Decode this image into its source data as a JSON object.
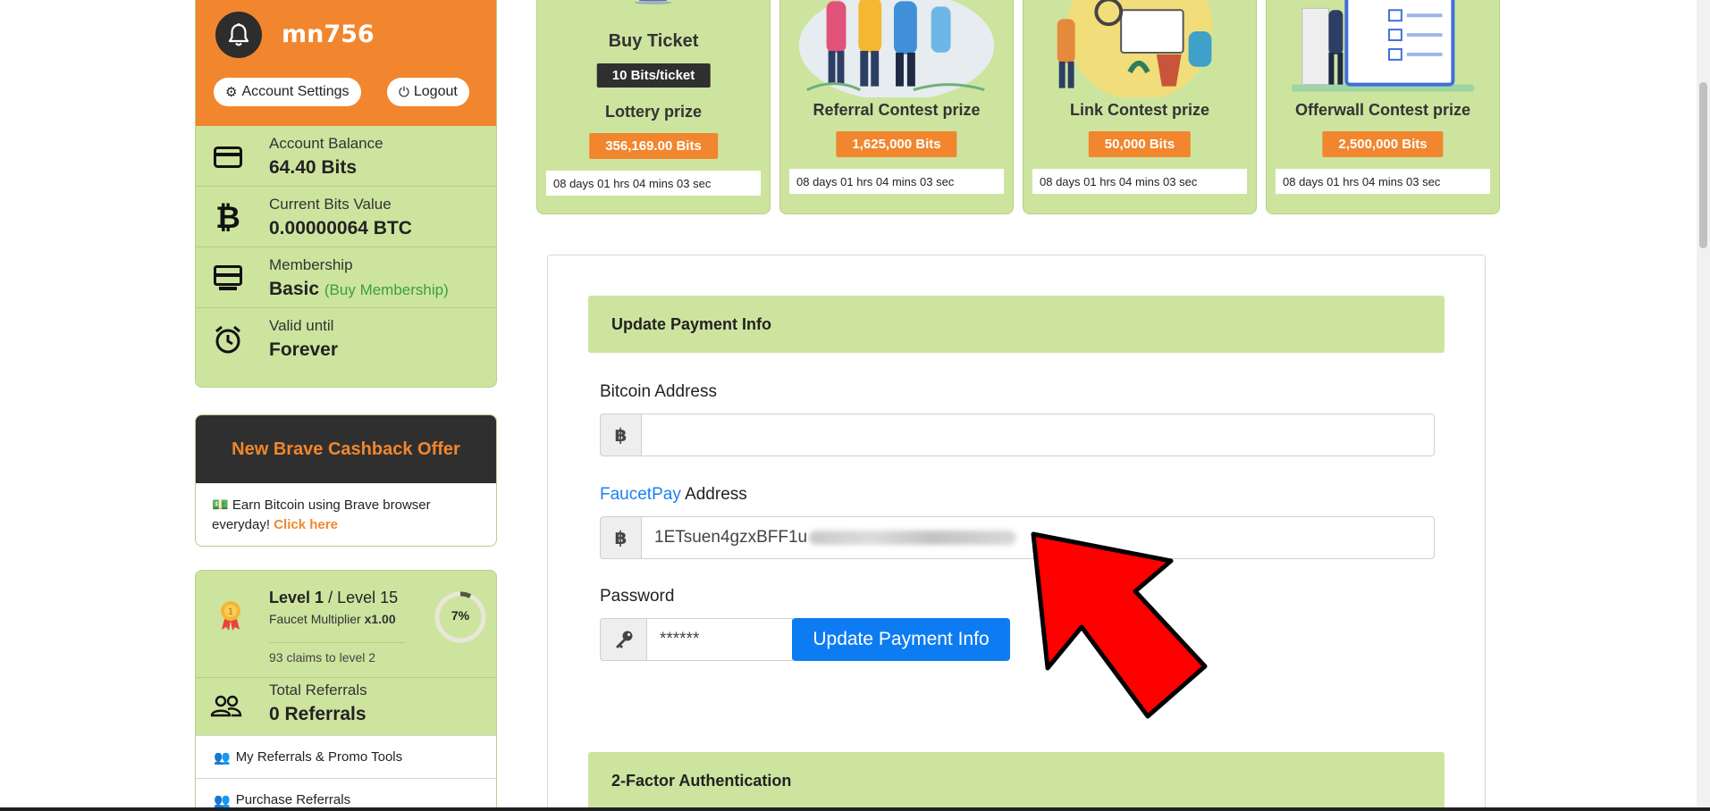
{
  "user": {
    "username": "mn756",
    "account_settings_label": "Account Settings",
    "logout_label": "Logout"
  },
  "stats": {
    "balance_label": "Account Balance",
    "balance_value": "64.40 Bits",
    "bits_value_label": "Current Bits Value",
    "bits_value": "0.00000064 BTC",
    "membership_label": "Membership",
    "membership_value": "Basic",
    "buy_membership": "(Buy Membership)",
    "valid_label": "Valid until",
    "valid_value": "Forever"
  },
  "brave": {
    "title": "New Brave Cashback Offer",
    "text": "Earn Bitcoin using Brave browser everyday!",
    "link": "Click here"
  },
  "level": {
    "current": "Level 1",
    "max": "/ Level 15",
    "multiplier_label": "Faucet Multiplier",
    "multiplier_value": "x1.00",
    "claims": "93 claims to level 2",
    "progress_text": "7%",
    "progress": 0.07
  },
  "referrals": {
    "label": "Total Referrals",
    "value": "0 Referrals",
    "promo_link": "My Referrals & Promo Tools",
    "purchase_link": "Purchase Referrals"
  },
  "contests": {
    "lottery": {
      "title": "Buy Ticket",
      "price": "10 Bits/ticket",
      "prize_label": "Lottery prize",
      "prize": "356,169.00 Bits",
      "timer": "08 days 01 hrs 04 mins 03 sec"
    },
    "referral": {
      "title": "Referral Contest prize",
      "prize": "1,625,000 Bits",
      "timer": "08 days 01 hrs 04 mins 03 sec"
    },
    "link": {
      "title": "Link Contest prize",
      "prize": "50,000 Bits",
      "timer": "08 days 01 hrs 04 mins 03 sec"
    },
    "offerwall": {
      "title": "Offerwall Contest prize",
      "prize": "2,500,000 Bits",
      "timer": "08 days 01 hrs 04 mins 03 sec"
    }
  },
  "payment": {
    "section_title": "Update Payment Info",
    "bitcoin_label": "Bitcoin Address",
    "bitcoin_value": "",
    "faucetpay_link": "FaucetPay",
    "faucetpay_label": "Address",
    "faucetpay_value": "1ETsuen4gzxBFF1u",
    "password_label": "Password",
    "password_value": "******",
    "update_button": "Update Payment Info"
  },
  "twofa": {
    "section_title": "2-Factor Authentication"
  },
  "colors": {
    "accent_orange": "#f1862e",
    "card_green": "#cde49f",
    "button_blue": "#0d7cf2",
    "arrow_red": "#ff0000"
  }
}
